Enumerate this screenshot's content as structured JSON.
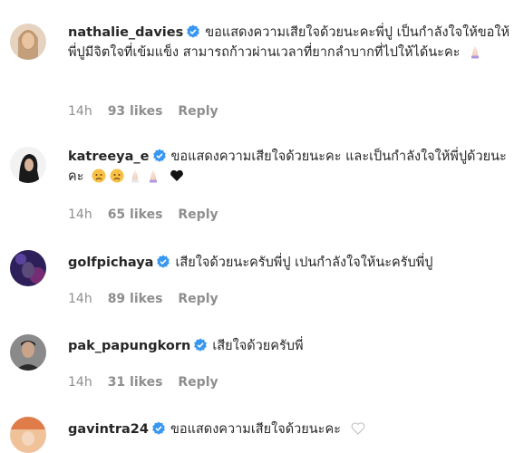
{
  "comments": [
    {
      "username": "nathalie_davies",
      "text": "ขอแสดงความเสียใจด้วยนะคะพี่ปู เป็นกำลังใจให้ขอให้พี่ปูมีจิตใจที่เข้มแข็ง สามารถก้าวผ่านเวลาที่ยากลำบากที่ไปให้ได้นะคะ",
      "emojis": [
        "folded-hands"
      ],
      "time": "14h",
      "likes": "93 likes",
      "reply": "Reply",
      "avatar_color": "#c9a98a"
    },
    {
      "username": "katreeya_e",
      "text": "ขอแสดงความเสียใจด้วยนะคะ และเป็นกำลังใจให้พี่ปูด้วยนะคะ",
      "emojis": [
        "sad-face",
        "sad-face",
        "folded-hands",
        "folded-hands",
        "black-heart"
      ],
      "time": "14h",
      "likes": "65 likes",
      "reply": "Reply",
      "avatar_color": "#2b2b2b"
    },
    {
      "username": "golfpichaya",
      "text": "เสียใจด้วยนะครับพี่ปู เปนกำลังใจให้นะครับพี่ปู",
      "emojis": [],
      "time": "14h",
      "likes": "89 likes",
      "reply": "Reply",
      "avatar_color": "#3a2d6e"
    },
    {
      "username": "pak_papungkorn",
      "text": "เสียใจด้วยครับพี่",
      "emojis": [],
      "time": "14h",
      "likes": "31 likes",
      "reply": "Reply",
      "avatar_color": "#4d4d4d"
    },
    {
      "username": "gavintra24",
      "text": "ขอแสดงความเสียใจด้วยนะคะ",
      "emojis": [
        "white-heart"
      ],
      "time": "",
      "likes": "",
      "reply": "",
      "avatar_color": "#d98c5f"
    }
  ],
  "colors": {
    "verified": "#3897f0",
    "muted": "#8e8e8e",
    "text": "#262626"
  }
}
